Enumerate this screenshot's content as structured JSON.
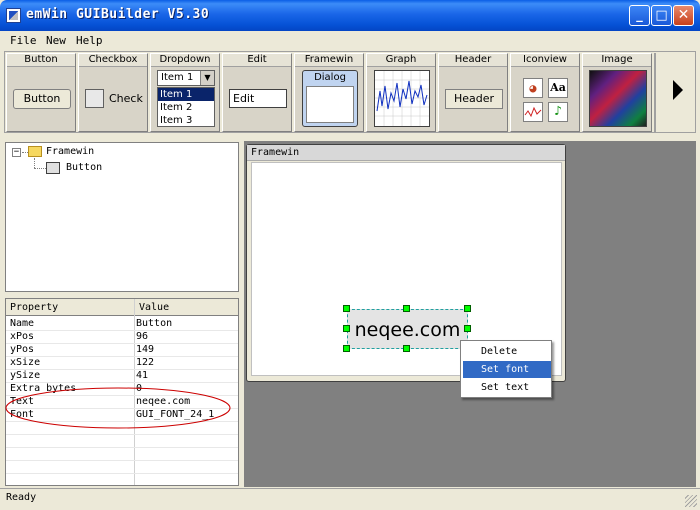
{
  "window": {
    "title": "emWin GUIBuilder V5.30"
  },
  "menu": {
    "items": [
      "File",
      "New",
      "Help"
    ]
  },
  "toolbar": {
    "groups": [
      {
        "label": "Button",
        "button_text": "Button"
      },
      {
        "label": "Checkbox",
        "check_text": "Check"
      },
      {
        "label": "Dropdown",
        "selected": "Item 1",
        "items": [
          "Item 1",
          "Item 2",
          "Item 3"
        ]
      },
      {
        "label": "Edit",
        "value": "Edit"
      },
      {
        "label": "Framewin",
        "inner": "Dialog"
      },
      {
        "label": "Graph"
      },
      {
        "label": "Header",
        "button_text": "Header"
      },
      {
        "label": "Iconview",
        "icon_aa": "Aa"
      },
      {
        "label": "Image"
      }
    ]
  },
  "tree": {
    "root": "Framewin",
    "child": "Button"
  },
  "properties": {
    "header": {
      "property": "Property",
      "value": "Value"
    },
    "rows": [
      {
        "name": "Name",
        "value": "Button"
      },
      {
        "name": "xPos",
        "value": "96"
      },
      {
        "name": "yPos",
        "value": "149"
      },
      {
        "name": "xSize",
        "value": "122"
      },
      {
        "name": "ySize",
        "value": "41"
      },
      {
        "name": "Extra bytes",
        "value": "0"
      },
      {
        "name": "Text",
        "value": "neqee.com"
      },
      {
        "name": "Font",
        "value": "GUI_FONT_24_1"
      }
    ]
  },
  "canvas": {
    "framewin_title": "Framewin",
    "button_text": "neqee.com"
  },
  "context_menu": {
    "items": [
      "Delete",
      "Set font",
      "Set text"
    ],
    "highlighted_index": 1
  },
  "status": {
    "text": "Ready"
  },
  "colors": {
    "titlebar": "#0552d6",
    "selection": "#316ac5",
    "handle": "#00ff00",
    "annotation": "#cc0000"
  }
}
